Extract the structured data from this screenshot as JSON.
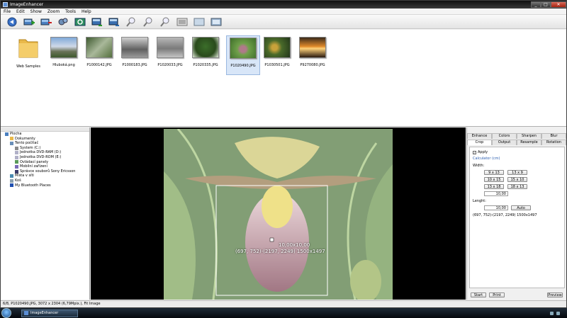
{
  "window": {
    "title": "ImageEnhancer"
  },
  "window_controls": {
    "minimize": "_",
    "maximize": "□",
    "close": "✕"
  },
  "menu": [
    "File",
    "Edit",
    "Show",
    "Zoom",
    "Tools",
    "Help"
  ],
  "toolbar_icons": [
    "back-icon",
    "add-images-icon",
    "remove-images-icon",
    "settings-icon",
    "refresh-icon",
    "import-icon",
    "export-icon",
    "zoom-in-icon",
    "zoom-out-icon",
    "zoom-fit-icon",
    "zoom-actual-icon",
    "fullscreen-icon",
    "slideshow-icon"
  ],
  "gallery": [
    {
      "label": "Web Samples",
      "kind": "folder"
    },
    {
      "label": "Hluboká.png",
      "kind": "castle"
    },
    {
      "label": "P1000142.JPG",
      "kind": "forest"
    },
    {
      "label": "P1000183.JPG",
      "kind": "street"
    },
    {
      "label": "P1020033.JPG",
      "kind": "gray"
    },
    {
      "label": "P1020335.JPG",
      "kind": "tree"
    },
    {
      "label": "P1020490.JPG",
      "kind": "flower",
      "selected": true
    },
    {
      "label": "P1030501.JPG",
      "kind": "plants"
    },
    {
      "label": "P9270080.JPG",
      "kind": "sunset"
    }
  ],
  "tree": [
    {
      "label": "Plocha",
      "level": 0,
      "icon": "desktop-icon"
    },
    {
      "label": "Dokumenty",
      "level": 1,
      "icon": "folder-icon"
    },
    {
      "label": "Tento počítač",
      "level": 1,
      "icon": "computer-icon"
    },
    {
      "label": "System (C:)",
      "level": 2,
      "icon": "drive-icon"
    },
    {
      "label": "Jednotka DVD-RAM (D:)",
      "level": 2,
      "icon": "dvd-icon"
    },
    {
      "label": "Jednotka DVD-ROM (E:)",
      "level": 2,
      "icon": "dvd-icon"
    },
    {
      "label": "Ovládací panely",
      "level": 2,
      "icon": "control-panel-icon"
    },
    {
      "label": "Mobilní zařízení",
      "level": 2,
      "icon": "mobile-icon"
    },
    {
      "label": "Správce souborů Sony Ericsson",
      "level": 2,
      "icon": "phone-icon"
    },
    {
      "label": "Místa v síti",
      "level": 1,
      "icon": "network-icon"
    },
    {
      "label": "Koš",
      "level": 1,
      "icon": "recycle-bin-icon"
    },
    {
      "label": "My Bluetooth Places",
      "level": 1,
      "icon": "bluetooth-icon"
    }
  ],
  "viewer": {
    "overlay_size": "10,00x10,00",
    "overlay_coords": "(697, 752)-(2197, 2249) 1500x1497"
  },
  "panel": {
    "tabs_row1": [
      "Enhance",
      "Colors",
      "Sharpen",
      "Blur"
    ],
    "tabs_row2": [
      "Crop",
      "Output",
      "Resample",
      "Rotation"
    ],
    "active_tab": "Crop",
    "apply_label": "Apply",
    "apply_checked": true,
    "calculator_label": "Calculator (cm)",
    "width_label": "Width:",
    "presets": [
      "9 x 13",
      "13 x 9",
      "10 x 15",
      "15 x 10",
      "13 x 18",
      "18 x 13"
    ],
    "width_value": "10,00",
    "length_label": "Lenght:",
    "length_value": "10,00",
    "auto_label": "Auto",
    "result": "(697, 752)-(2197, 2249) 1500x1497",
    "start_label": "Start",
    "print_label": "Print",
    "preview_label": "Preview"
  },
  "status": {
    "text": "6/8, P1020490.JPG, 3072 x 2304 (6,79Mpix.), Fit Image"
  },
  "taskbar": {
    "task_label": "ImageEnhancer"
  },
  "colors": {
    "accent": "#5b8fd6",
    "selection": "#d8e6f8"
  }
}
